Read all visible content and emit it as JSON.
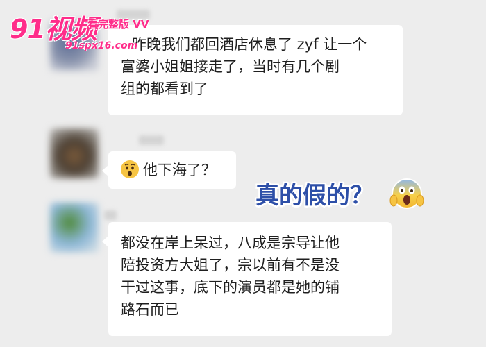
{
  "watermark": {
    "site_logo": "91视频",
    "tagline": "看完整版 ⅤⅤ",
    "url": "91spx16.com"
  },
  "messages": [
    {
      "sender": "blurred-contact-1",
      "lines": [
        "昨晚我们都回酒店休息了 zyf 让一个",
        "富婆小姐姐接走了，当时有几个剧",
        "组的都看到了"
      ]
    },
    {
      "sender": "blurred-contact-2",
      "emoji": "astonished-face-icon",
      "text": "他下海了？"
    },
    {
      "sender": "blurred-contact-3",
      "lines": [
        "都没在岸上呆过，八成是宗导让他",
        "陪投资方大姐了，宗以前有不是没",
        "干过这事，底下的演员都是她的铺",
        "路石而已"
      ]
    }
  ],
  "overlay": {
    "caption": "真的假的？",
    "emoji": "screaming-face-icon"
  },
  "colors": {
    "background": "#ededed",
    "bubble": "#ffffff",
    "watermark_pink": "#ff2d8a",
    "caption_blue": "#2d4fa8"
  }
}
